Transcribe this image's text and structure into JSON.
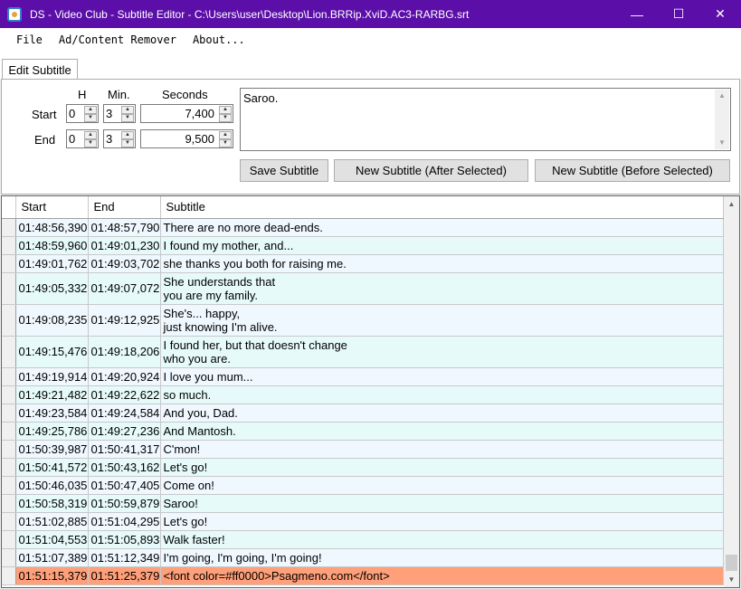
{
  "window": {
    "title": "DS - Video Club - Subtitle Editor - C:\\Users\\user\\Desktop\\Lion.BRRip.XviD.AC3-RARBG.srt",
    "icon": "app-icon",
    "minimize_glyph": "—",
    "maximize_glyph": "☐",
    "close_glyph": "✕"
  },
  "menu": {
    "items": [
      "File",
      "Ad/Content Remover",
      "About..."
    ]
  },
  "tabs": [
    {
      "label": "Edit Subtitle",
      "active": true
    }
  ],
  "editor": {
    "col_h": "H",
    "col_min": "Min.",
    "col_seconds": "Seconds",
    "start_label": "Start",
    "end_label": "End",
    "start": {
      "h": "0",
      "min": "3",
      "seconds": "7,400"
    },
    "end": {
      "h": "0",
      "min": "3",
      "seconds": "9,500"
    },
    "text": "Saroo.",
    "buttons": {
      "save": "Save Subtitle",
      "new_after": "New Subtitle (After Selected)",
      "new_before": "New Subtitle (Before Selected)"
    }
  },
  "grid": {
    "columns": [
      "Start",
      "End",
      "Subtitle"
    ],
    "rows": [
      {
        "start": "01:48:56,390",
        "end": "01:48:57,790",
        "lines": [
          "There are no more dead-ends."
        ]
      },
      {
        "start": "01:48:59,960",
        "end": "01:49:01,230",
        "lines": [
          "I found my mother, and..."
        ]
      },
      {
        "start": "01:49:01,762",
        "end": "01:49:03,702",
        "lines": [
          "she thanks you both for raising me."
        ]
      },
      {
        "start": "01:49:05,332",
        "end": "01:49:07,072",
        "lines": [
          "She understands that",
          "you are my family."
        ]
      },
      {
        "start": "01:49:08,235",
        "end": "01:49:12,925",
        "lines": [
          "She's... happy,",
          "just knowing I'm alive."
        ]
      },
      {
        "start": "01:49:15,476",
        "end": "01:49:18,206",
        "lines": [
          "I found her, but that doesn't change",
          "who you are."
        ]
      },
      {
        "start": "01:49:19,914",
        "end": "01:49:20,924",
        "lines": [
          "I love you mum..."
        ]
      },
      {
        "start": "01:49:21,482",
        "end": "01:49:22,622",
        "lines": [
          "so much."
        ]
      },
      {
        "start": "01:49:23,584",
        "end": "01:49:24,584",
        "lines": [
          "And you, Dad."
        ]
      },
      {
        "start": "01:49:25,786",
        "end": "01:49:27,236",
        "lines": [
          "And Mantosh."
        ]
      },
      {
        "start": "01:50:39,987",
        "end": "01:50:41,317",
        "lines": [
          "C'mon!"
        ]
      },
      {
        "start": "01:50:41,572",
        "end": "01:50:43,162",
        "lines": [
          "Let's go!"
        ]
      },
      {
        "start": "01:50:46,035",
        "end": "01:50:47,405",
        "lines": [
          "Come on!"
        ]
      },
      {
        "start": "01:50:58,319",
        "end": "01:50:59,879",
        "lines": [
          "Saroo!"
        ]
      },
      {
        "start": "01:51:02,885",
        "end": "01:51:04,295",
        "lines": [
          "Let's go!"
        ]
      },
      {
        "start": "01:51:04,553",
        "end": "01:51:05,893",
        "lines": [
          "Walk faster!"
        ]
      },
      {
        "start": "01:51:07,389",
        "end": "01:51:12,349",
        "lines": [
          "I'm going, I'm going, I'm going!"
        ]
      },
      {
        "start": "01:51:15,379",
        "end": "01:51:25,379",
        "lines": [
          "<font color=#ff0000>Psagmeno.com</font>"
        ],
        "selected": true
      }
    ]
  },
  "colors": {
    "titlebar": "#5b0fa8",
    "row_even": "#f0f8ff",
    "row_odd": "#e6fafa",
    "row_selected": "#ffa07a"
  }
}
